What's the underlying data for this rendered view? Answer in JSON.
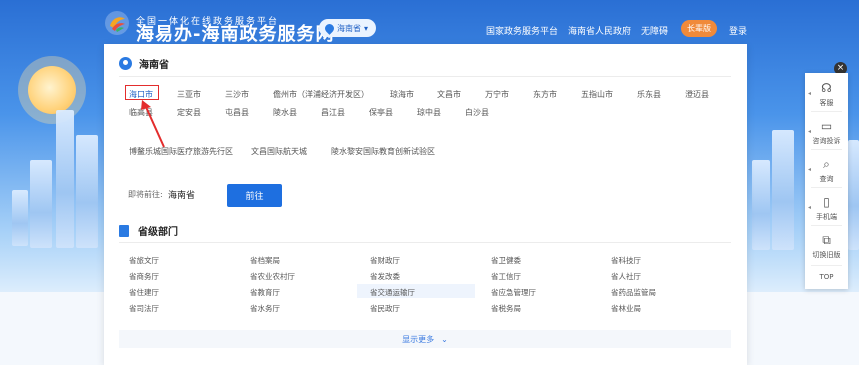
{
  "header": {
    "portal_subtitle": "全国一体化在线政务服务平台",
    "portal_title": "海易办-海南政务服务网",
    "region_selector": "海南省",
    "nav": [
      "国家政务服务平台",
      "海南省人民政府",
      "无障碍"
    ],
    "elder_mode": "长辈版",
    "login": "登录"
  },
  "province_panel": {
    "title": "海南省",
    "cities_row1": [
      "海口市",
      "三亚市",
      "三沙市",
      "儋州市（洋浦经济开发区）",
      "琼海市",
      "文昌市",
      "万宁市",
      "东方市",
      "五指山市",
      "乐东县",
      "澄迈县"
    ],
    "cities_row2": [
      "临高县",
      "定安县",
      "屯昌县",
      "陵水县",
      "昌江县",
      "保亭县",
      "琼中县",
      "白沙县"
    ],
    "zones": [
      "博鳌乐城国际医疗旅游先行区",
      "文昌国际航天城",
      "陵水黎安国际教育创新试验区"
    ],
    "selected_city": "海口市",
    "goto_label": "即将前往:",
    "goto_value": "海南省",
    "goto_button": "前往"
  },
  "departments": {
    "title": "省级部门",
    "columns": [
      [
        "省旅文厅",
        "省商务厅",
        "省住建厅",
        "省司法厅"
      ],
      [
        "省档案局",
        "省农业农村厅",
        "省教育厅",
        "省水务厅"
      ],
      [
        "省财政厅",
        "省发改委",
        "省交通运输厅",
        "省民政厅"
      ],
      [
        "省卫健委",
        "省工信厅",
        "省应急管理厅",
        "省税务局"
      ],
      [
        "省科技厅",
        "省人社厅",
        "省药品监管局",
        "省林业局"
      ]
    ],
    "show_more": "显示更多"
  },
  "side_toolbar": {
    "items": [
      "客服",
      "咨询投诉",
      "查询",
      "手机端",
      "切换旧版"
    ],
    "top": "TOP"
  },
  "colors": {
    "accent": "#1e6fe0",
    "elder_button": "#f08a3a",
    "selection_highlight": "#e32d2d"
  }
}
